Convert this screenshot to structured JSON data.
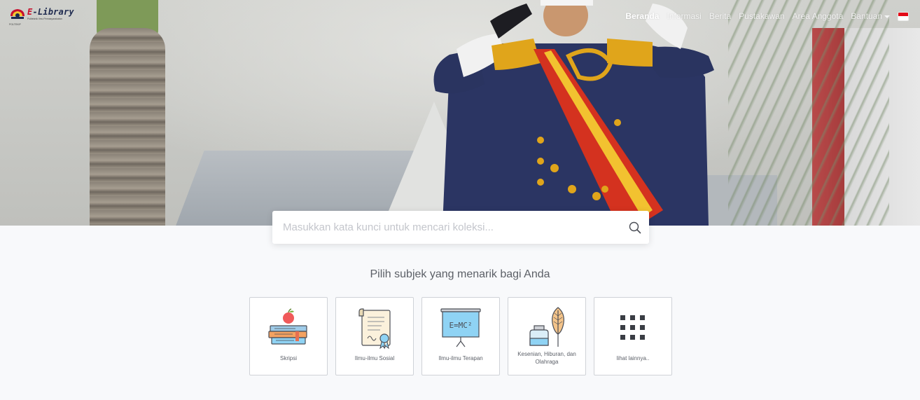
{
  "brand": {
    "title_first": "E",
    "title_rest": "-Library",
    "subtitle": "Politeknik Ilmu Pemasyarakatan",
    "caption": "POLTEKIP"
  },
  "nav": {
    "items": [
      {
        "label": "Beranda",
        "active": true
      },
      {
        "label": "Informasi",
        "active": false
      },
      {
        "label": "Berita",
        "active": false
      },
      {
        "label": "Pustakawan",
        "active": false
      },
      {
        "label": "Area Anggota",
        "active": false
      },
      {
        "label": "Bantuan",
        "active": false
      }
    ],
    "language_flag": "indonesia-flag-icon"
  },
  "search": {
    "placeholder": "Masukkan kata kunci untuk mencari koleksi...",
    "value": "",
    "icon": "search-icon"
  },
  "subjects": {
    "title": "Pilih subjek yang menarik bagi Anda",
    "items": [
      {
        "label": "Skripsi",
        "icon": "books-apple-icon"
      },
      {
        "label": "Ilmu-ilmu Sosial",
        "icon": "certificate-scroll-icon"
      },
      {
        "label": "Ilmu-ilmu Terapan",
        "icon": "emc2-board-icon"
      },
      {
        "label": "Kesenian, Hiburan, dan Olahraga",
        "icon": "ink-quill-icon"
      },
      {
        "label": "lihat lainnya..",
        "icon": "grid-dots-icon"
      }
    ]
  },
  "colors": {
    "background": "#f8f9fb",
    "card_border": "#cfd2d7",
    "brand_red": "#c8102e",
    "brand_navy": "#1e2a4f"
  }
}
